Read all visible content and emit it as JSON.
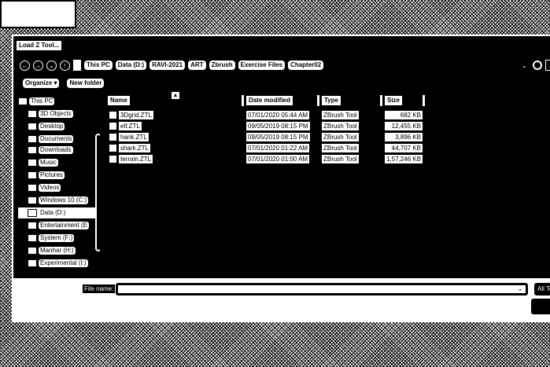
{
  "window": {
    "title": "Load Z Tool..."
  },
  "breadcrumbs": [
    "This PC",
    "Data (D:)",
    "RAVI-2021",
    "ART",
    "Zbrush",
    "Exercise Files",
    "Chapter02"
  ],
  "toolbar": {
    "organize": "Organize ▾",
    "new_folder": "New folder"
  },
  "sidebar": {
    "items": [
      {
        "label": "This PC",
        "icon": "computer-icon"
      },
      {
        "label": "3D Objects",
        "icon": "cube-icon"
      },
      {
        "label": "Desktop",
        "icon": "desktop-icon"
      },
      {
        "label": "Documents",
        "icon": "document-icon"
      },
      {
        "label": "Downloads",
        "icon": "download-icon"
      },
      {
        "label": "Music",
        "icon": "music-icon"
      },
      {
        "label": "Pictures",
        "icon": "pictures-icon"
      },
      {
        "label": "Videos",
        "icon": "video-icon"
      },
      {
        "label": "Windows 10 (C:)",
        "icon": "drive-icon"
      },
      {
        "label": "Data (D:)",
        "icon": "drive-icon"
      },
      {
        "label": "Entertainment (E",
        "icon": "drive-icon"
      },
      {
        "label": "System (F:)",
        "icon": "drive-icon"
      },
      {
        "label": "Manhar (H:)",
        "icon": "drive-icon"
      },
      {
        "label": "Experimental (I:)",
        "icon": "drive-icon"
      }
    ]
  },
  "columns": {
    "name": "Name",
    "date": "Date modified",
    "type": "Type",
    "size": "Size"
  },
  "files": [
    {
      "name": "3Dgrid.ZTL",
      "date": "07/01/2020 05:44 AM",
      "type": "ZBrush Tool",
      "size": "682 KB"
    },
    {
      "name": "elf.ZTL",
      "date": "09/05/2019 08:15 PM",
      "type": "ZBrush Tool",
      "size": "12,455 KB"
    },
    {
      "name": "hank.ZTL",
      "date": "09/05/2019 08:15 PM",
      "type": "ZBrush Tool",
      "size": "3,896 KB"
    },
    {
      "name": "shark.ZTL",
      "date": "07/01/2020 01:22 AM",
      "type": "ZBrush Tool",
      "size": "44,707 KB"
    },
    {
      "name": "terrain.ZTL",
      "date": "07/01/2020 01:00 AM",
      "type": "ZBrush Tool",
      "size": "1,57,246 KB"
    }
  ],
  "footer": {
    "filename_label": "File name:",
    "filename_value": "",
    "filter_label": "All Tc"
  },
  "glyphs": {
    "back": "←",
    "forward": "→",
    "down": "⌄",
    "up": "↑",
    "sort": "▲",
    "dropdown": "⌄",
    "combo": "⌄"
  }
}
